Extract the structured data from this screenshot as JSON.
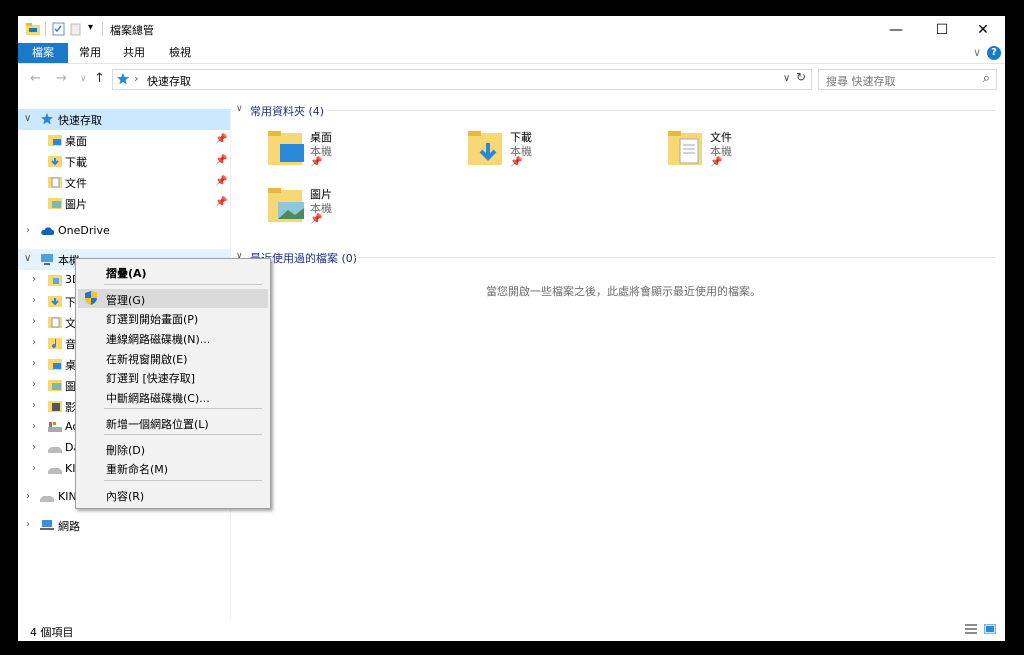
{
  "titlebar": {
    "title": "檔案總管",
    "qa_dropdown": "▾",
    "minimize": "—",
    "maximize": "☐",
    "close": "✕"
  },
  "ribbon": {
    "tabs": [
      "檔案",
      "常用",
      "共用",
      "檢視"
    ],
    "active_tab": 0,
    "help": "?",
    "expand": "∨"
  },
  "address": {
    "path": "快速存取",
    "separator": "›",
    "dropdown": "∨",
    "refresh": "↻",
    "search_placeholder": "搜尋 快速存取",
    "search_icon": "⌕"
  },
  "nav": {
    "quick_access": {
      "label": "快速存取",
      "chevron": "∨"
    },
    "pinned": [
      {
        "label": "桌面",
        "icon": "desktop-folder-icon"
      },
      {
        "label": "下載",
        "icon": "downloads-folder-icon"
      },
      {
        "label": "文件",
        "icon": "documents-folder-icon"
      },
      {
        "label": "圖片",
        "icon": "pictures-folder-icon"
      }
    ],
    "onedrive": {
      "label": "OneDrive",
      "chevron": "›"
    },
    "this_pc": {
      "label": "本機",
      "chevron": "∨"
    },
    "this_pc_children": [
      {
        "label": "3D",
        "icon": "3d-objects-icon"
      },
      {
        "label": "下",
        "icon": "downloads-folder-icon"
      },
      {
        "label": "文",
        "icon": "documents-folder-icon"
      },
      {
        "label": "音",
        "icon": "music-folder-icon"
      },
      {
        "label": "桌",
        "icon": "desktop-folder-icon"
      },
      {
        "label": "圖",
        "icon": "pictures-folder-icon"
      },
      {
        "label": "影",
        "icon": "videos-folder-icon"
      },
      {
        "label": "Ac",
        "icon": "os-drive-icon"
      },
      {
        "label": "Da",
        "icon": "drive-icon"
      },
      {
        "label": "KI",
        "icon": "usb-drive-icon"
      }
    ],
    "kingston": {
      "label": "KIN",
      "chevron": "›"
    },
    "network": {
      "label": "網路",
      "chevron": "›"
    },
    "pin_glyph": "📌"
  },
  "main": {
    "frequent_header": "常用資料夾 (4)",
    "frequent": [
      {
        "name": "桌面",
        "location": "本機"
      },
      {
        "name": "下載",
        "location": "本機"
      },
      {
        "name": "文件",
        "location": "本機"
      },
      {
        "name": "圖片",
        "location": "本機"
      }
    ],
    "recent_header": "最近使用過的檔案 (0)",
    "empty_message": "當您開啟一些檔案之後，此處將會顯示最近使用的檔案。",
    "group_chevron": "∨"
  },
  "status": {
    "count": "4 個項目"
  },
  "context_menu": {
    "items": [
      {
        "label": "摺疊(A)",
        "bold": true
      },
      {
        "label": "管理(G)",
        "hover": true,
        "icon": "admin-shield-icon"
      },
      {
        "label": "釘選到開始畫面(P)"
      },
      {
        "label": "連線網路磁碟機(N)..."
      },
      {
        "label": "在新視窗開啟(E)"
      },
      {
        "label": "釘選到 [快速存取]"
      },
      {
        "label": "中斷網路磁碟機(C)..."
      },
      {
        "label": "新增一個網路位置(L)"
      },
      {
        "label": "刪除(D)"
      },
      {
        "label": "重新命名(M)"
      },
      {
        "label": "內容(R)"
      }
    ]
  },
  "colors": {
    "accent": "#1979ca",
    "selection": "#cce8ff",
    "folder": "#f8d775",
    "folder_dark": "#e8b93a",
    "group_header": "#1e3287"
  }
}
